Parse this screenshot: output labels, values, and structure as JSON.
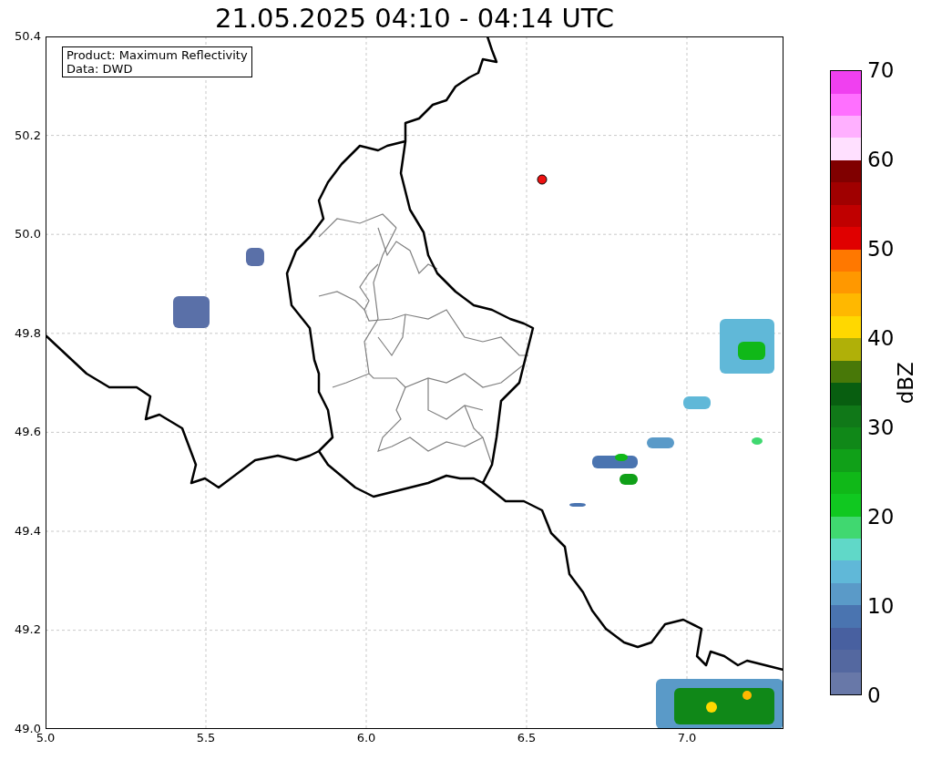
{
  "title": "21.05.2025 04:10 - 04:14 UTC",
  "map": {
    "legend": [
      "Product: Maximum Reflectivity",
      "Data: DWD"
    ],
    "yticks": [
      "50.4",
      "50.2",
      "50.0",
      "49.8",
      "49.6",
      "49.4",
      "49.2",
      "49.0"
    ],
    "xticks": [
      "5.0",
      "5.5",
      "6.0",
      "6.5",
      "7.0"
    ]
  },
  "colorbar": {
    "label": "dBZ",
    "ticks": [
      "70",
      "60",
      "50",
      "40",
      "30",
      "20",
      "10",
      "0"
    ],
    "segments": [
      {
        "color": "#6878a8"
      },
      {
        "color": "#5468a0"
      },
      {
        "color": "#4860a0"
      },
      {
        "color": "#4a74b0"
      },
      {
        "color": "#5a9ac8"
      },
      {
        "color": "#60b8d8"
      },
      {
        "color": "#60d8c8"
      },
      {
        "color": "#40d870"
      },
      {
        "color": "#10c820"
      },
      {
        "color": "#10b818"
      },
      {
        "color": "#10a018"
      },
      {
        "color": "#108818"
      },
      {
        "color": "#107818"
      },
      {
        "color": "#085e10"
      },
      {
        "color": "#487808"
      },
      {
        "color": "#b0b008"
      },
      {
        "color": "#ffd800"
      },
      {
        "color": "#ffb800"
      },
      {
        "color": "#ff9800"
      },
      {
        "color": "#ff7800"
      },
      {
        "color": "#e00000"
      },
      {
        "color": "#c00000"
      },
      {
        "color": "#a00000"
      },
      {
        "color": "#800000"
      },
      {
        "color": "#ffe0ff"
      },
      {
        "color": "#ffb0ff"
      },
      {
        "color": "#ff70ff"
      },
      {
        "color": "#f040f0"
      }
    ]
  }
}
